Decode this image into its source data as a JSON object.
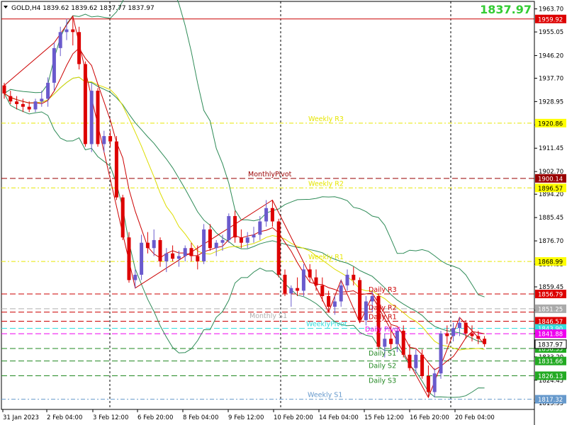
{
  "header": {
    "symbol_line": "GOLD,H4  1839.62 1839.62 1837.77 1837.97",
    "current_price": "1837.97"
  },
  "chart_data": {
    "type": "candlestick",
    "symbol": "GOLD",
    "timeframe": "H4",
    "ohlc_display": {
      "open": 1839.62,
      "high": 1839.62,
      "low": 1837.77,
      "close": 1837.97
    },
    "ylim": [
      1813.5,
      1966.5
    ],
    "price_ticks": [
      1963.7,
      1955.05,
      1946.2,
      1937.7,
      1928.95,
      1920.2,
      1911.45,
      1902.7,
      1894.2,
      1885.45,
      1876.7,
      1867.95,
      1859.45,
      1850.7,
      1841.95,
      1833.2,
      1824.45,
      1815.95
    ],
    "time_labels": [
      "31 Jan 2023",
      "2 Feb 04:00",
      "3 Feb 12:00",
      "6 Feb 20:00",
      "8 Feb 04:00",
      "9 Feb 12:00",
      "10 Feb 20:00",
      "14 Feb 04:00",
      "15 Feb 12:00",
      "16 Feb 20:00",
      "20 Feb 04:00"
    ],
    "day_separators": [
      2,
      24,
      78,
      55,
      91
    ],
    "levels": [
      {
        "label": "",
        "price": 1959.92,
        "color": "#cc0000",
        "style": "solid",
        "tag": "1959.92",
        "tag_bg": "#dd0000",
        "tag_fg": "#ffffff"
      },
      {
        "label": "Weekly R3",
        "price": 1920.86,
        "color": "#e6e600",
        "style": "dashdot",
        "tag": "1920.86",
        "tag_bg": "#ffff00",
        "tag_fg": "#000000"
      },
      {
        "label": "MonthlyPivot",
        "price": 1900.14,
        "color": "#990000",
        "style": "dashed",
        "tag": "1900.14",
        "tag_bg": "#990000",
        "tag_fg": "#ffffff"
      },
      {
        "label": "Weekly R2",
        "price": 1896.57,
        "color": "#e6e600",
        "style": "dashdot",
        "tag": "1896.57",
        "tag_bg": "#ffff00",
        "tag_fg": "#000000"
      },
      {
        "label": "Weekly R1",
        "price": 1868.99,
        "color": "#e6e600",
        "style": "dashdot",
        "tag": "1868.99",
        "tag_bg": "#ffff00",
        "tag_fg": "#000000"
      },
      {
        "label": "Daily R3",
        "price": 1856.79,
        "color": "#cc0000",
        "style": "dashed",
        "tag": "1856.79",
        "tag_bg": "#dd0000",
        "tag_fg": "#ffffff"
      },
      {
        "label": "Monthly S1",
        "price": 1851.25,
        "color": "#b0b0b0",
        "style": "dashed",
        "tag": "1851.25",
        "tag_bg": "#aaaaaa",
        "tag_fg": "#ffffff"
      },
      {
        "label": "Daily R2",
        "price": 1850.0,
        "color": "#cc0000",
        "style": "dashed",
        "tag": "",
        "tag_bg": "",
        "tag_fg": ""
      },
      {
        "label": "Daily R1",
        "price": 1846.57,
        "color": "#cc0000",
        "style": "dashed",
        "tag": "1846.57",
        "tag_bg": "#dd0000",
        "tag_fg": "#ffffff"
      },
      {
        "label": "WeeklyPivot",
        "price": 1843.9,
        "color": "#33dddd",
        "style": "dashed",
        "tag": "1843.90",
        "tag_bg": "#33dddd",
        "tag_fg": "#ffffff"
      },
      {
        "label": "Daily Pivot",
        "price": 1841.88,
        "color": "#ee00ee",
        "style": "dashed",
        "tag": "1841.88",
        "tag_bg": "#ee00ee",
        "tag_fg": "#ffffff"
      },
      {
        "label": "Daily S1",
        "price": 1836.35,
        "color": "#228822",
        "style": "dashed",
        "tag": "1836.35",
        "tag_bg": "#22aa22",
        "tag_fg": "#ffffff"
      },
      {
        "label": "Daily S2",
        "price": 1831.66,
        "color": "#228822",
        "style": "dashed",
        "tag": "1831.66",
        "tag_bg": "#22aa22",
        "tag_fg": "#ffffff"
      },
      {
        "label": "Daily S3",
        "price": 1826.13,
        "color": "#228822",
        "style": "dashed",
        "tag": "1826.13",
        "tag_bg": "#22aa22",
        "tag_fg": "#ffffff"
      },
      {
        "label": "Weekly S1",
        "price": 1817.32,
        "color": "#6699cc",
        "style": "dashdot",
        "tag": "1817.32",
        "tag_bg": "#6699cc",
        "tag_fg": "#ffffff"
      }
    ],
    "candles": [
      [
        1935,
        1936,
        1930,
        1932
      ],
      [
        1931,
        1933,
        1928,
        1929
      ],
      [
        1929,
        1931,
        1926,
        1928
      ],
      [
        1928,
        1930,
        1925,
        1927
      ],
      [
        1927,
        1929,
        1925,
        1926
      ],
      [
        1926,
        1930,
        1925,
        1929
      ],
      [
        1929,
        1933,
        1927,
        1930
      ],
      [
        1930,
        1938,
        1927,
        1936
      ],
      [
        1936,
        1951,
        1933,
        1949
      ],
      [
        1949,
        1957,
        1946,
        1955
      ],
      [
        1955,
        1960,
        1952,
        1956
      ],
      [
        1956,
        1961,
        1950,
        1955
      ],
      [
        1955,
        1957,
        1941,
        1943
      ],
      [
        1943,
        1944,
        1912,
        1913
      ],
      [
        1913,
        1936,
        1910,
        1933
      ],
      [
        1933,
        1934,
        1912,
        1913
      ],
      [
        1913,
        1918,
        1910,
        1916
      ],
      [
        1916,
        1918,
        1912,
        1914
      ],
      [
        1914,
        1916,
        1892,
        1893
      ],
      [
        1893,
        1894,
        1877,
        1878
      ],
      [
        1878,
        1880,
        1861,
        1862
      ],
      [
        1862,
        1866,
        1859,
        1864
      ],
      [
        1864,
        1879,
        1862,
        1876
      ],
      [
        1876,
        1880,
        1872,
        1874
      ],
      [
        1874,
        1881,
        1871,
        1877
      ],
      [
        1877,
        1878,
        1867,
        1869
      ],
      [
        1869,
        1874,
        1865,
        1872
      ],
      [
        1872,
        1875,
        1869,
        1870
      ],
      [
        1870,
        1873,
        1867,
        1871
      ],
      [
        1871,
        1875,
        1869,
        1874
      ],
      [
        1874,
        1876,
        1869,
        1871
      ],
      [
        1871,
        1875,
        1866,
        1869
      ],
      [
        1869,
        1883,
        1868,
        1881
      ],
      [
        1881,
        1883,
        1873,
        1874
      ],
      [
        1874,
        1877,
        1871,
        1876
      ],
      [
        1876,
        1879,
        1873,
        1877
      ],
      [
        1877,
        1887,
        1876,
        1886
      ],
      [
        1886,
        1888,
        1876,
        1878
      ],
      [
        1878,
        1881,
        1874,
        1876
      ],
      [
        1876,
        1880,
        1874,
        1878
      ],
      [
        1878,
        1882,
        1876,
        1879
      ],
      [
        1879,
        1886,
        1877,
        1884
      ],
      [
        1884,
        1892,
        1882,
        1889
      ],
      [
        1889,
        1892,
        1882,
        1884
      ],
      [
        1884,
        1885,
        1863,
        1864
      ],
      [
        1864,
        1866,
        1856,
        1857
      ],
      [
        1857,
        1860,
        1852,
        1859
      ],
      [
        1859,
        1863,
        1856,
        1858
      ],
      [
        1858,
        1868,
        1856,
        1866
      ],
      [
        1866,
        1868,
        1861,
        1863
      ],
      [
        1863,
        1866,
        1858,
        1860
      ],
      [
        1860,
        1863,
        1854,
        1856
      ],
      [
        1856,
        1858,
        1850,
        1852
      ],
      [
        1852,
        1856,
        1849,
        1854
      ],
      [
        1854,
        1862,
        1852,
        1860
      ],
      [
        1860,
        1866,
        1858,
        1864
      ],
      [
        1864,
        1867,
        1860,
        1862
      ],
      [
        1862,
        1863,
        1846,
        1847
      ],
      [
        1847,
        1856,
        1845,
        1854
      ],
      [
        1854,
        1858,
        1850,
        1856
      ],
      [
        1856,
        1857,
        1836,
        1837
      ],
      [
        1837,
        1842,
        1833,
        1840
      ],
      [
        1840,
        1845,
        1836,
        1838
      ],
      [
        1838,
        1844,
        1835,
        1843
      ],
      [
        1843,
        1845,
        1833,
        1834
      ],
      [
        1834,
        1838,
        1828,
        1829
      ],
      [
        1829,
        1836,
        1827,
        1834
      ],
      [
        1834,
        1836,
        1825,
        1826
      ],
      [
        1826,
        1830,
        1818,
        1820
      ],
      [
        1820,
        1829,
        1818,
        1827
      ],
      [
        1827,
        1843,
        1825,
        1842
      ],
      [
        1842,
        1845,
        1838,
        1841
      ],
      [
        1841,
        1846,
        1839,
        1844
      ],
      [
        1844,
        1848,
        1841,
        1846
      ],
      [
        1846,
        1847,
        1840,
        1842
      ],
      [
        1842,
        1845,
        1839,
        1841
      ],
      [
        1841,
        1843,
        1838,
        1840
      ],
      [
        1840,
        1841,
        1837,
        1838
      ]
    ]
  }
}
